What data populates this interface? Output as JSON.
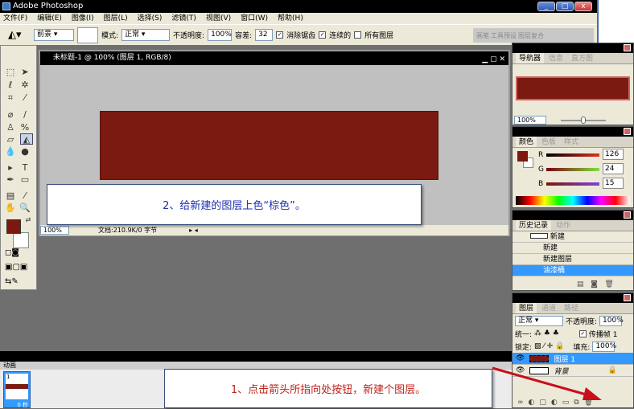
{
  "app": {
    "title": "Adobe Photoshop"
  },
  "menu": [
    "文件(F)",
    "编辑(E)",
    "图像(I)",
    "图层(L)",
    "选择(S)",
    "滤镜(T)",
    "视图(V)",
    "窗口(W)",
    "帮助(H)"
  ],
  "options": {
    "fill_source": "前景",
    "mode_label": "模式:",
    "mode": "正常",
    "opacity_label": "不透明度:",
    "opacity": "100%",
    "tolerance_label": "容差:",
    "tolerance": "32",
    "antialias": "消除锯齿",
    "contiguous": "连续的",
    "all_layers": "所有图层",
    "wells": [
      "画笔",
      "工具预设",
      "图层复合"
    ]
  },
  "document": {
    "title": "未标题-1 @ 100% (图层 1, RGB/8)",
    "zoom": "100%",
    "doc_info": "文档:210.9K/0 字节"
  },
  "colors": {
    "foreground": "#7e180f",
    "background": "#ffffff"
  },
  "callouts": {
    "step2": "2、给新建的图层上色“棕色”。",
    "step1": "1、点击箭头所指向处按钮，新建个图层。"
  },
  "navigator": {
    "tabs": [
      "导航器",
      "信息",
      "直方图"
    ],
    "zoom": "100%"
  },
  "color_panel": {
    "tabs": [
      "颜色",
      "色板",
      "样式"
    ],
    "r_label": "R",
    "g_label": "G",
    "b_label": "B",
    "r": "126",
    "g": "24",
    "b": "15"
  },
  "history": {
    "tabs": [
      "历史记录",
      "动作"
    ],
    "snapshot": "新建",
    "items": [
      "新建",
      "新建图层",
      "油漆桶"
    ]
  },
  "layers": {
    "tabs": [
      "图层",
      "通道",
      "路径"
    ],
    "blend": "正常",
    "opacity_label": "不透明度:",
    "opacity": "100%",
    "unify_label": "统一:",
    "propagate": "传播帧 1",
    "lock_label": "锁定:",
    "fill_label": "填充:",
    "fill": "100%",
    "items": [
      "图层 1",
      "背景"
    ]
  },
  "animation": {
    "tab": "动画",
    "frame_number": "1",
    "frame_delay": "0 秒"
  }
}
